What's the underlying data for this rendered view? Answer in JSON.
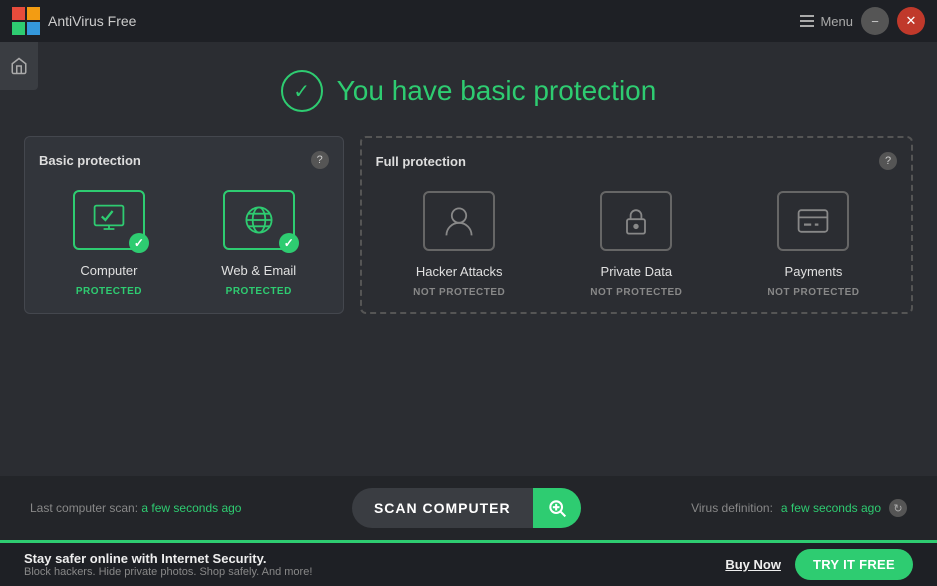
{
  "titlebar": {
    "app_name": "AntiVirus Free",
    "menu_label": "Menu",
    "minimize_label": "−",
    "close_label": "✕"
  },
  "header": {
    "status_icon": "✓",
    "title": "You have basic protection"
  },
  "panels": {
    "basic": {
      "title": "Basic protection",
      "help": "?",
      "items": [
        {
          "name": "Computer",
          "status": "PROTECTED",
          "type": "protected"
        },
        {
          "name": "Web & Email",
          "status": "PROTECTED",
          "type": "protected"
        }
      ]
    },
    "full": {
      "title": "Full protection",
      "help": "?",
      "items": [
        {
          "name": "Hacker Attacks",
          "status": "NOT PROTECTED",
          "type": "unprotected"
        },
        {
          "name": "Private Data",
          "status": "NOT PROTECTED",
          "type": "unprotected"
        },
        {
          "name": "Payments",
          "status": "NOT PROTECTED",
          "type": "unprotected"
        }
      ]
    }
  },
  "bottombar": {
    "scan_label": "Last computer scan:",
    "scan_time": "a few seconds ago",
    "scan_button": "SCAN COMPUTER",
    "virus_label": "Virus definition:",
    "virus_time": "a few seconds ago"
  },
  "promobar": {
    "main_text": "Stay safer online with Internet Security.",
    "sub_text": "Block hackers. Hide private photos. Shop safely. And more!",
    "buy_label": "Buy Now",
    "try_label": "TRY IT FREE"
  },
  "colors": {
    "green": "#2ecc71",
    "dark_bg": "#2b2d32",
    "panel_bg": "#32353b",
    "border": "#44474e",
    "unprotected": "#666666"
  }
}
